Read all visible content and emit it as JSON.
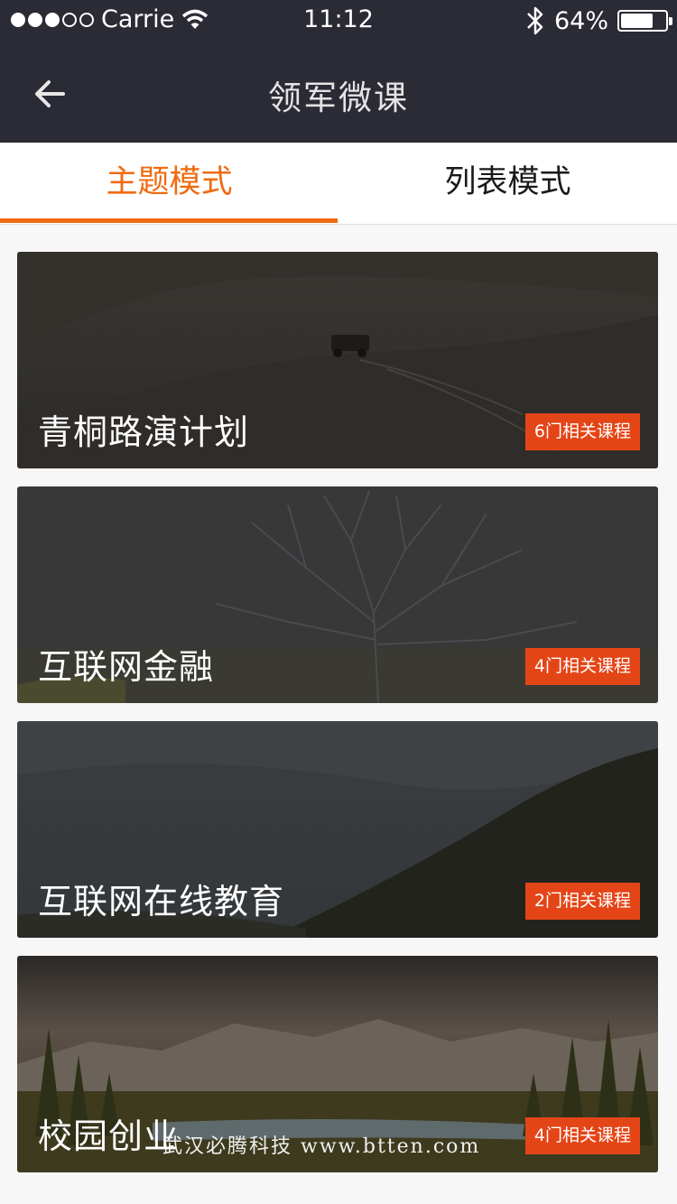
{
  "status_bar": {
    "carrier": "Carrie",
    "time": "11:12",
    "battery": "64%",
    "battery_level": 0.64
  },
  "nav": {
    "title": "领军微课"
  },
  "tabs": [
    {
      "label": "主题模式",
      "active": true
    },
    {
      "label": "列表模式",
      "active": false
    }
  ],
  "cards": [
    {
      "title": "青桐路演计划",
      "badge": "6门相关课程"
    },
    {
      "title": "互联网金融",
      "badge": "4门相关课程"
    },
    {
      "title": "互联网在线教育",
      "badge": "2门相关课程"
    },
    {
      "title": "校园创业",
      "badge": "4门相关课程"
    }
  ],
  "watermark": "武汉必腾科技 www.btten.com",
  "colors": {
    "accent": "#f06a10",
    "badge": "#e44517",
    "header": "#2a2b35"
  }
}
